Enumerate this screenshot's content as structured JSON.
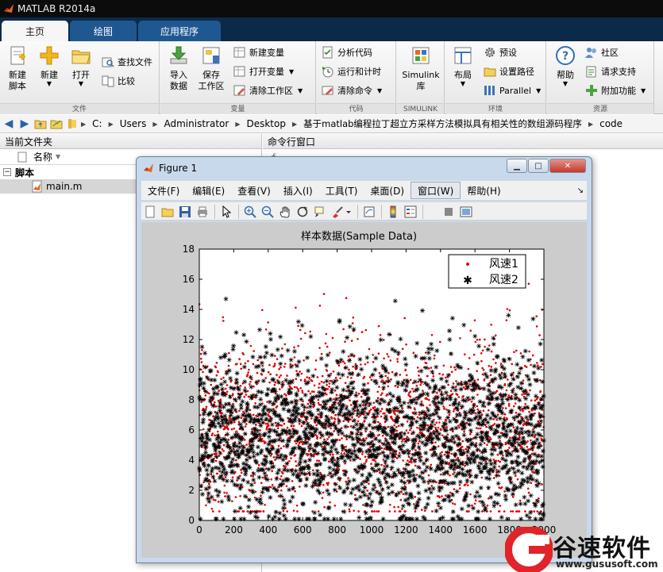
{
  "app": {
    "title": "MATLAB R2014a"
  },
  "tabs": [
    {
      "label": "主页"
    },
    {
      "label": "绘图"
    },
    {
      "label": "应用程序"
    }
  ],
  "ribbon": {
    "file": {
      "label": "文件",
      "new_script": "新建\n脚本",
      "new": "新建",
      "open": "打开",
      "find_files": "查找文件",
      "compare": "比较"
    },
    "variable": {
      "label": "变量",
      "import_data": "导入\n数据",
      "save_workspace": "保存\n工作区",
      "new_variable": "新建变量",
      "open_variable": "打开变量",
      "clear_workspace": "清除工作区"
    },
    "code": {
      "label": "代码",
      "analyze_code": "分析代码",
      "run_and_time": "运行和计时",
      "clear_commands": "清除命令"
    },
    "simulink": {
      "label": "SIMULINK",
      "library": "Simulink\n库"
    },
    "environment": {
      "label": "环境",
      "layout": "布局",
      "preferences": "预设",
      "set_path": "设置路径",
      "parallel": "Parallel"
    },
    "resources": {
      "label": "资源",
      "help": "帮助",
      "community": "社区",
      "request_support": "请求支持",
      "add_ons": "附加功能"
    }
  },
  "address": {
    "crumbs": [
      "C:",
      "Users",
      "Administrator",
      "Desktop",
      "基于matlab编程拉丁超立方采样方法模拟具有相关性的数组源码程序",
      "code"
    ]
  },
  "folder_panel": {
    "title": "当前文件夹",
    "name_header": "名称",
    "group": "脚本",
    "file": "main.m"
  },
  "command_panel": {
    "title": "命令行窗口",
    "prompt": "f"
  },
  "figure": {
    "title": "Figure 1",
    "menu": [
      "文件(F)",
      "编辑(E)",
      "查看(V)",
      "插入(I)",
      "工具(T)",
      "桌面(D)",
      "窗口(W)",
      "帮助(H)"
    ],
    "active_menu_index": 6
  },
  "chart_data": {
    "type": "scatter",
    "title": "样本数据(Sample Data)",
    "xlim": [
      0,
      2000
    ],
    "ylim": [
      0,
      18
    ],
    "xticks": [
      0,
      200,
      400,
      600,
      800,
      1000,
      1200,
      1400,
      1600,
      1800,
      2000
    ],
    "yticks": [
      0,
      2,
      4,
      6,
      8,
      10,
      12,
      14,
      16,
      18
    ],
    "grid": false,
    "legend_position": "top-right",
    "n_points_per_series": 2000,
    "series": [
      {
        "name": "风速1",
        "marker": "dot",
        "color": "#e00000",
        "mean": 6.3,
        "std": 2.9,
        "min": 0.6,
        "max": 15.7
      },
      {
        "name": "风速2",
        "marker": "star",
        "color": "#000000",
        "mean": 5.6,
        "std": 2.8,
        "min": 0.1,
        "max": 16.5
      }
    ]
  },
  "watermark": {
    "name": "谷速软件",
    "url": "www.gususoft.com"
  },
  "colors": {
    "title_bar": "#0c0c0c",
    "tab_strip": "#0b2a4a",
    "tab_inactive": "#1f5891",
    "ribbon": "#eeeeee",
    "figure_frame": "#c9d9ec",
    "figure_canvas": "#cccccc",
    "series1": "#e00000",
    "series2": "#000000",
    "watermark_red": "#e0242a"
  }
}
